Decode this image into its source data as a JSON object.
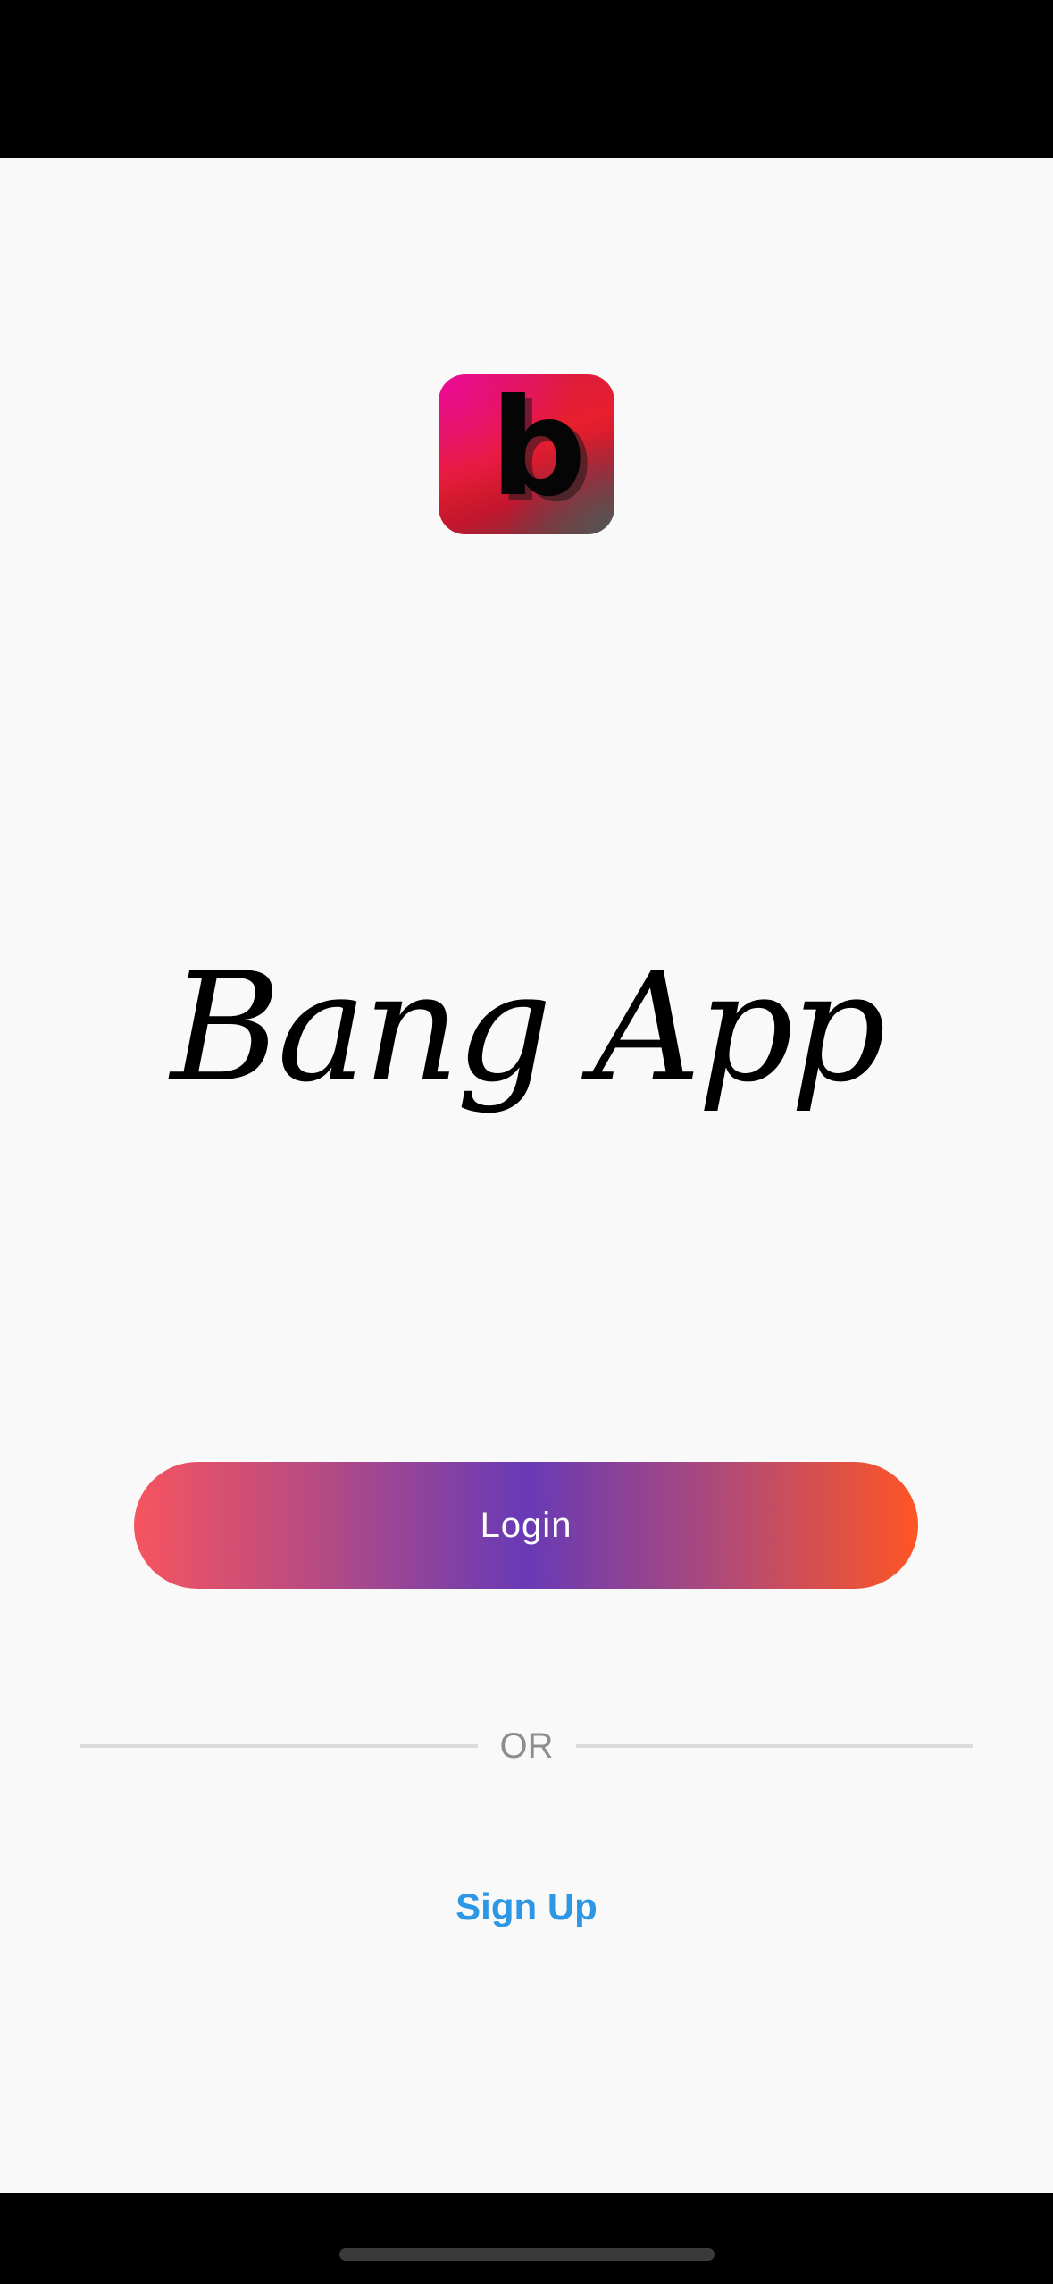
{
  "app": {
    "icon_letter": "b",
    "title": "Bang App"
  },
  "actions": {
    "login_label": "Login",
    "divider_label": "OR",
    "signup_label": "Sign Up"
  },
  "colors": {
    "background": "#f9f9f9",
    "login_gradient": [
      "#f6545f",
      "#683ab6",
      "#fe5524"
    ],
    "signup_link": "#2d97e6",
    "divider_line": "#dcdcdc",
    "divider_text": "#8e8e8e",
    "icon_gradient": [
      "#ee0a98",
      "#e81f2c",
      "#555555"
    ]
  },
  "icons": {
    "app_logo": "app-logo-icon"
  }
}
